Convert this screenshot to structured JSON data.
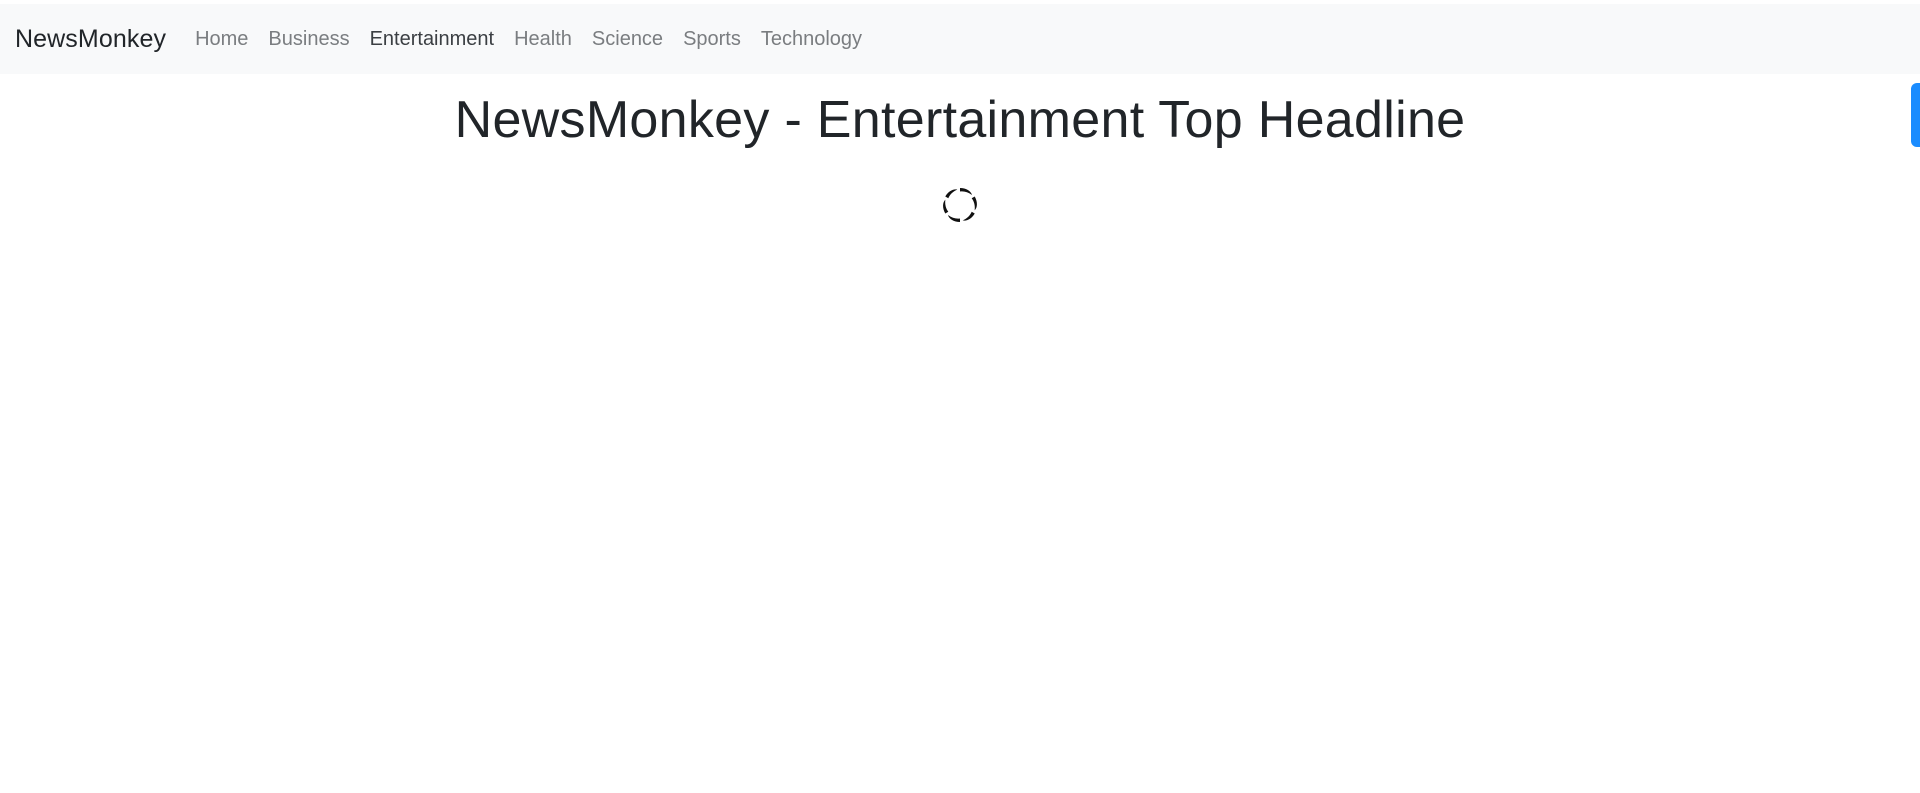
{
  "navbar": {
    "brand": "NewsMonkey",
    "links": [
      {
        "label": "Home"
      },
      {
        "label": "Business"
      },
      {
        "label": "Entertainment"
      },
      {
        "label": "Health"
      },
      {
        "label": "Science"
      },
      {
        "label": "Sports"
      },
      {
        "label": "Technology"
      }
    ],
    "active": "Entertainment",
    "background": "#f8f9fa"
  },
  "main": {
    "headline": "NewsMonkey - Entertainment Top Headline",
    "loading_icon": "spinner-icon"
  },
  "colors": {
    "accent": "#1a8cff",
    "text": "#212529",
    "muted": "#7a7d80"
  }
}
